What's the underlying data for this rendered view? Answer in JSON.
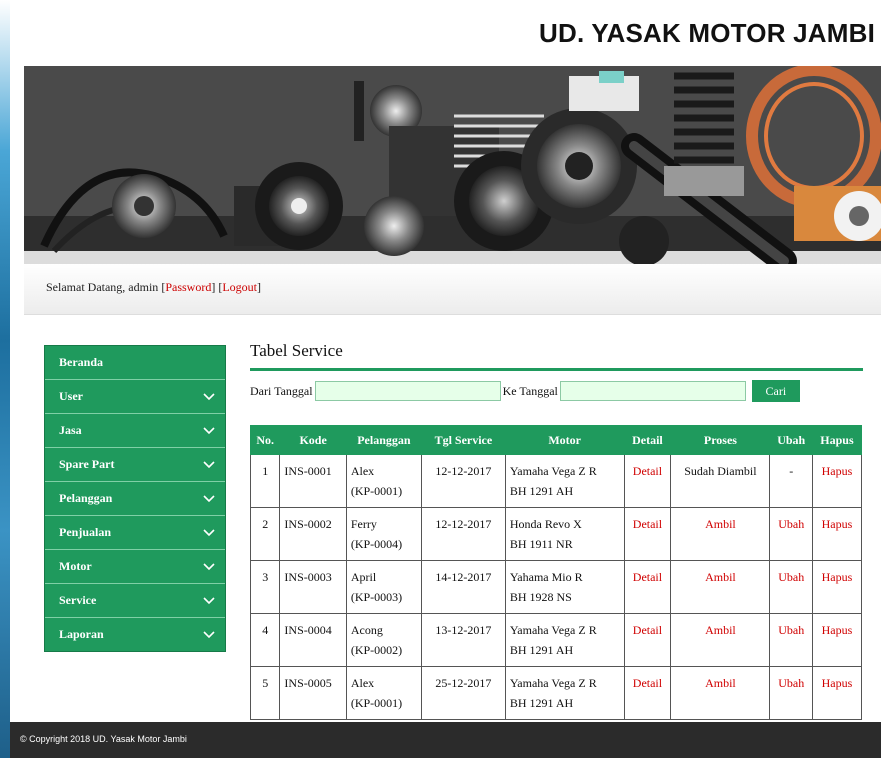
{
  "site_title": "UD. YASAK MOTOR JAMBI",
  "welcome": {
    "text": "Selamat Datang, admin",
    "password_label": "Password",
    "logout_label": "Logout"
  },
  "sidebar": {
    "items": [
      {
        "label": "Beranda",
        "has_chevron": false
      },
      {
        "label": "User",
        "has_chevron": true
      },
      {
        "label": "Jasa",
        "has_chevron": true
      },
      {
        "label": "Spare Part",
        "has_chevron": true
      },
      {
        "label": "Pelanggan",
        "has_chevron": true
      },
      {
        "label": "Penjualan",
        "has_chevron": true
      },
      {
        "label": "Motor",
        "has_chevron": true
      },
      {
        "label": "Service",
        "has_chevron": true
      },
      {
        "label": "Laporan",
        "has_chevron": true
      }
    ]
  },
  "main": {
    "title": "Tabel Service",
    "filter": {
      "from_label": "Dari Tanggal",
      "from_value": "",
      "to_label": "Ke Tanggal",
      "to_value": "",
      "search_button": "Cari"
    },
    "table": {
      "headers": [
        "No.",
        "Kode",
        "Pelanggan",
        "Tgl Service",
        "Motor",
        "Detail",
        "Proses",
        "Ubah",
        "Hapus"
      ],
      "rows": [
        {
          "no": "1",
          "kode": "INS-0001",
          "pelanggan_name": "Alex",
          "pelanggan_code": "(KP-0001)",
          "tgl": "12-12-2017",
          "motor_name": "Yamaha Vega Z R",
          "motor_plate": "BH 1291 AH",
          "detail": "Detail",
          "proses": "Sudah Diambil",
          "ubah": "-",
          "hapus": "Hapus"
        },
        {
          "no": "2",
          "kode": "INS-0002",
          "pelanggan_name": "Ferry",
          "pelanggan_code": "(KP-0004)",
          "tgl": "12-12-2017",
          "motor_name": "Honda Revo X",
          "motor_plate": "BH 1911 NR",
          "detail": "Detail",
          "proses": "Ambil",
          "ubah": "Ubah",
          "hapus": "Hapus"
        },
        {
          "no": "3",
          "kode": "INS-0003",
          "pelanggan_name": "April",
          "pelanggan_code": "(KP-0003)",
          "tgl": "14-12-2017",
          "motor_name": "Yahama Mio R",
          "motor_plate": "BH 1928 NS",
          "detail": "Detail",
          "proses": "Ambil",
          "ubah": "Ubah",
          "hapus": "Hapus"
        },
        {
          "no": "4",
          "kode": "INS-0004",
          "pelanggan_name": "Acong",
          "pelanggan_code": "(KP-0002)",
          "tgl": "13-12-2017",
          "motor_name": "Yamaha Vega Z R",
          "motor_plate": "BH 1291 AH",
          "detail": "Detail",
          "proses": "Ambil",
          "ubah": "Ubah",
          "hapus": "Hapus"
        },
        {
          "no": "5",
          "kode": "INS-0005",
          "pelanggan_name": "Alex",
          "pelanggan_code": "(KP-0001)",
          "tgl": "25-12-2017",
          "motor_name": "Yamaha Vega Z R",
          "motor_plate": "BH 1291 AH",
          "detail": "Detail",
          "proses": "Ambil",
          "ubah": "Ubah",
          "hapus": "Hapus"
        }
      ]
    }
  },
  "footer": {
    "copyright": "© Copyright 2018 UD. Yasak Motor Jambi"
  },
  "colors": {
    "accent_green": "#1f9a5d",
    "link_red": "#d00000",
    "footer_bg": "#2b2b2b"
  }
}
